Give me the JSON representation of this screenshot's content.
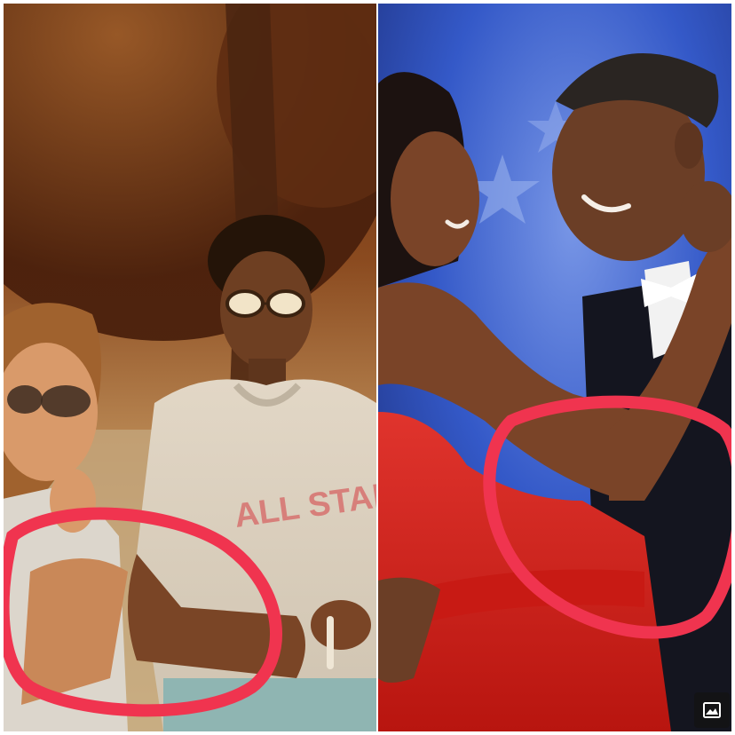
{
  "image": {
    "alt": "",
    "shirt_text": "ALL STAR",
    "colors": {
      "circle_annotation": "#f0344f",
      "dress": "#d4201e",
      "background_stage": "#2f55c4",
      "vintage_foliage": "#7a3f18",
      "overlay_icon_bg": "#141414"
    }
  },
  "overlay": {
    "icon": "image-gallery-icon"
  }
}
